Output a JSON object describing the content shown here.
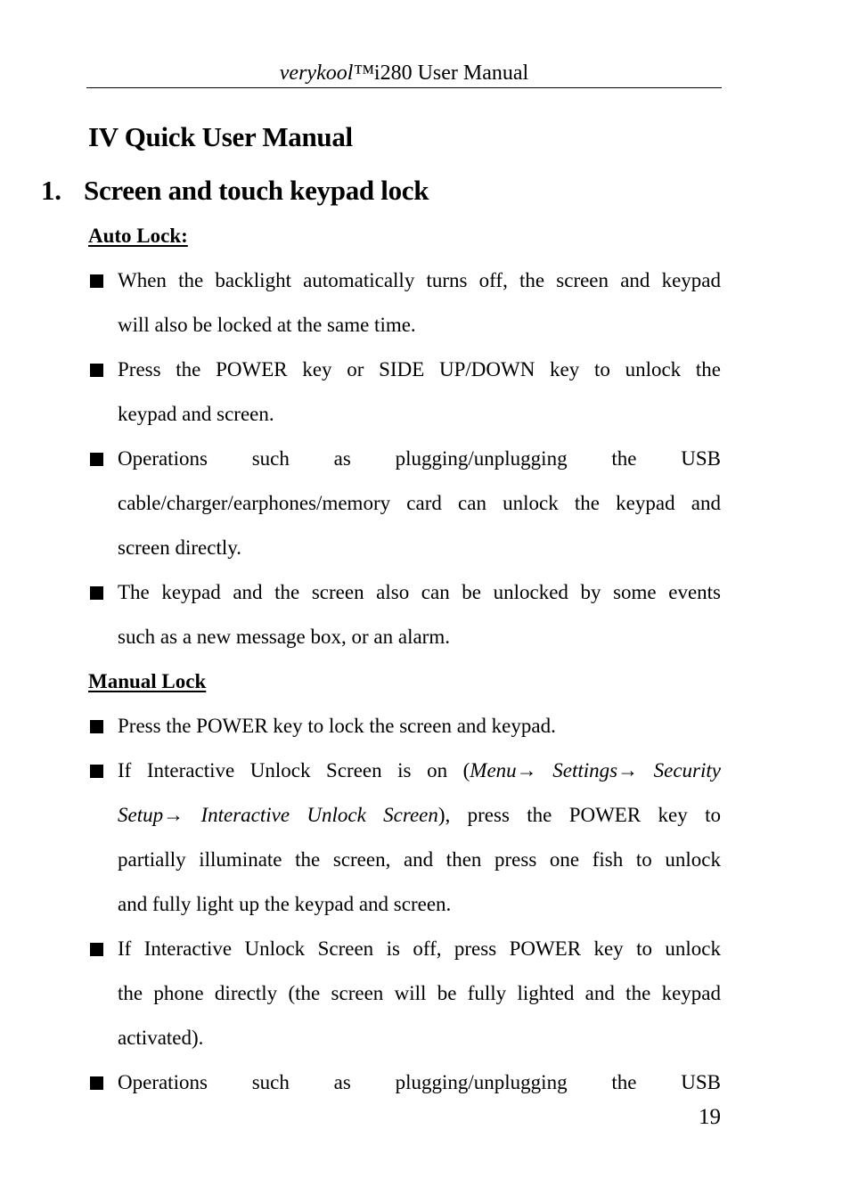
{
  "header": {
    "brand": "verykool™",
    "title_rest": "i280 User Manual"
  },
  "chapter_title": "IV Quick User Manual",
  "section": {
    "number": "1.",
    "title": "Screen and touch keypad lock"
  },
  "auto_lock": {
    "heading": "Auto Lock:",
    "bullets": [
      {
        "lines": [
          "When the backlight automatically turns off, the screen and keypad",
          "will also be locked at the same time."
        ]
      },
      {
        "lines": [
          "Press the POWER key or SIDE UP/DOWN key to unlock the",
          "keypad and screen."
        ]
      },
      {
        "lines": [
          "Operations such as plugging/unplugging the USB",
          "cable/charger/earphones/memory card can unlock the keypad and",
          "screen directly."
        ]
      },
      {
        "lines": [
          "The keypad and the screen also can be unlocked by some events",
          "such as a new message box, or  an alarm."
        ]
      }
    ]
  },
  "manual_lock": {
    "heading": "Manual Lock",
    "bullets": [
      {
        "lines": [
          "Press the POWER key to lock the screen and keypad."
        ]
      },
      {
        "line1_pre": "If Interactive Unlock Screen is on (",
        "path": [
          "Menu",
          "Settings",
          "Security Setup",
          "Interactive Unlock Screen"
        ],
        "path_line1_a": "Menu",
        "arrow": "→",
        "path_line1_b": "Settings",
        "path_line1_c": "Security",
        "path_line2_a": "Setup",
        "path_line2_b": "Interactive Unlock Screen",
        "line2_post": "), press the POWER key to",
        "lines_rest": [
          "partially illuminate the screen, and then press one fish to unlock",
          "and fully light up the keypad and screen."
        ]
      },
      {
        "lines": [
          "If Interactive Unlock Screen is off, press POWER key to unlock",
          "the phone directly (the screen will be fully lighted and the keypad",
          "activated)."
        ]
      },
      {
        "lines": [
          "Operations such as plugging/unplugging the USB"
        ]
      }
    ]
  },
  "page_number": "19"
}
